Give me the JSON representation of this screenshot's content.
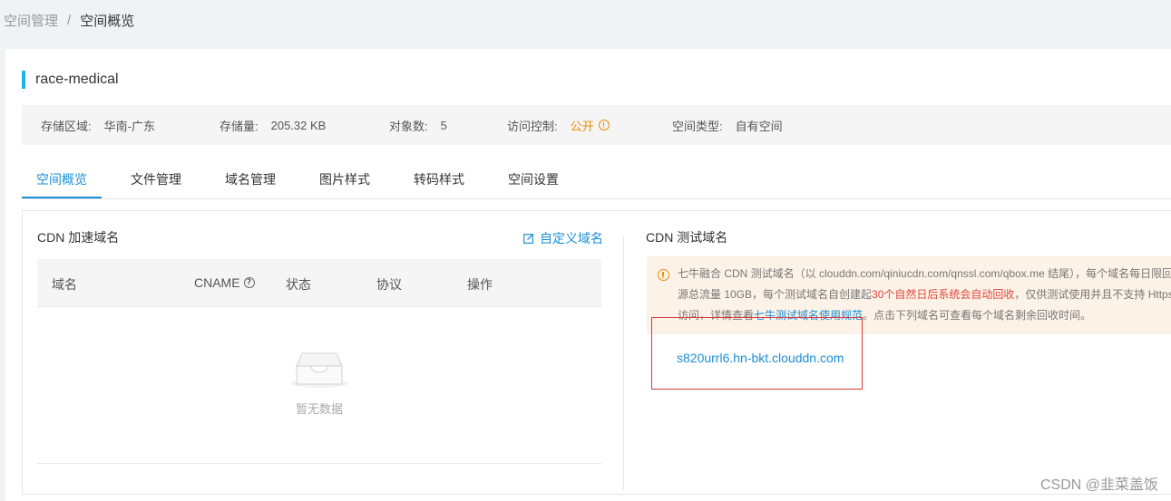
{
  "breadcrumb": {
    "parent": "空间管理",
    "separator": "/",
    "current": "空间概览"
  },
  "bucket": {
    "name": "race-medical"
  },
  "info": {
    "region_label": "存储区域:",
    "region_value": "华南-广东",
    "storage_label": "存储量:",
    "storage_value": "205.32 KB",
    "objects_label": "对象数:",
    "objects_value": "5",
    "access_label": "访问控制:",
    "access_value": "公开",
    "type_label": "空间类型:",
    "type_value": "自有空间",
    "accent_color": "#f08c00"
  },
  "tabs": [
    {
      "label": "空间概览",
      "active": true
    },
    {
      "label": "文件管理"
    },
    {
      "label": "域名管理"
    },
    {
      "label": "图片样式"
    },
    {
      "label": "转码样式"
    },
    {
      "label": "空间设置"
    }
  ],
  "cdn": {
    "title": "CDN 加速域名",
    "custom_domain_label": "自定义域名",
    "columns": [
      "域名",
      "CNAME",
      "状态",
      "协议",
      "操作"
    ],
    "empty_text": "暂无数据"
  },
  "test_cdn": {
    "title": "CDN 测试域名",
    "notice": {
      "line1": "七牛融合 CDN 测试域名（以 clouddn.com/qiniucdn.com/qnssl.com/qbox.me 结尾），每个域名每日限回",
      "line2_a": "源总流量 10GB，每个测试域名自创建起",
      "line2_red": "30个自然日后系统会自动回收",
      "line2_b": "，仅供测试使用并且不支持 Https",
      "line3_a": "访问，详情查看",
      "line3_link": "七牛测试域名使用规范",
      "line3_b": "。点击下列域名可查看每个域名剩余回收时间。"
    },
    "domain": "s820urrl6.hn-bkt.clouddn.com"
  },
  "watermark": "CSDN @韭菜盖饭",
  "colors": {
    "primary": "#1a8fd6",
    "warning": "#f08c00",
    "danger": "#e0473c"
  }
}
